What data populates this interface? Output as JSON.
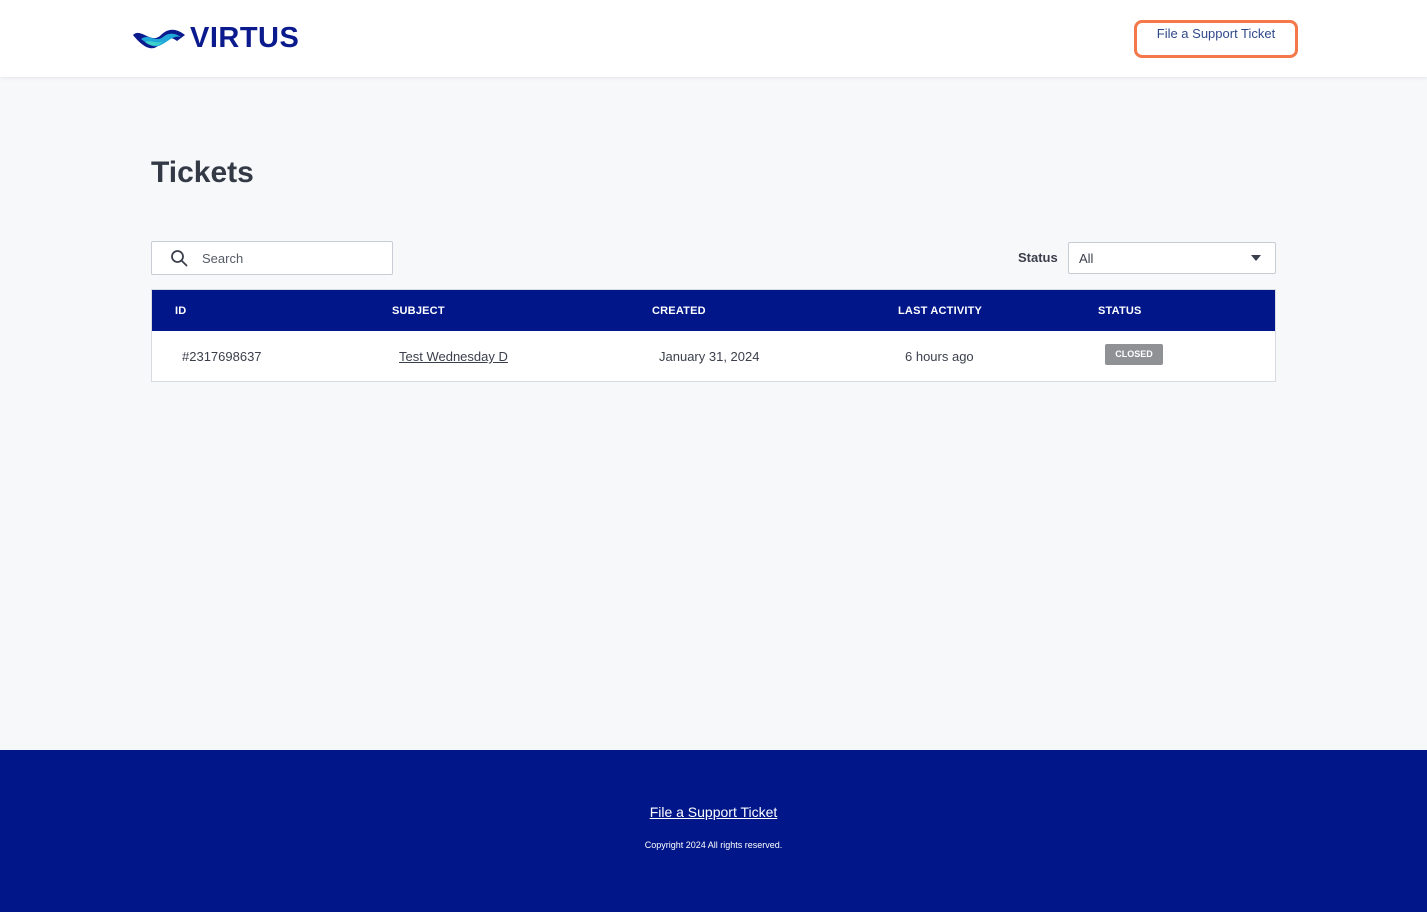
{
  "header": {
    "brand": "VIRTUS",
    "support_link": "File a Support Ticket"
  },
  "main": {
    "title": "Tickets",
    "search": {
      "placeholder": "Search",
      "value": ""
    },
    "status_filter": {
      "label": "Status",
      "selected": "All"
    }
  },
  "table": {
    "columns": [
      "ID",
      "SUBJECT",
      "CREATED",
      "LAST ACTIVITY",
      "STATUS"
    ],
    "rows": [
      {
        "id": "#2317698637",
        "subject": "Test Wednesday D",
        "created": "January 31, 2024",
        "last_activity": "6 hours ago",
        "status": "CLOSED"
      }
    ]
  },
  "footer": {
    "support_link": "File a Support Ticket",
    "copyright": "Copyright 2024 All rights reserved."
  },
  "colors": {
    "brand_navy": "#001689",
    "highlight_orange": "#f4784a",
    "badge_gray": "#8f9194",
    "page_bg": "#f7f8fa"
  },
  "icons": {
    "logo": "virtus-wave-logo-icon",
    "search": "search-icon",
    "dropdown": "caret-down-icon"
  }
}
